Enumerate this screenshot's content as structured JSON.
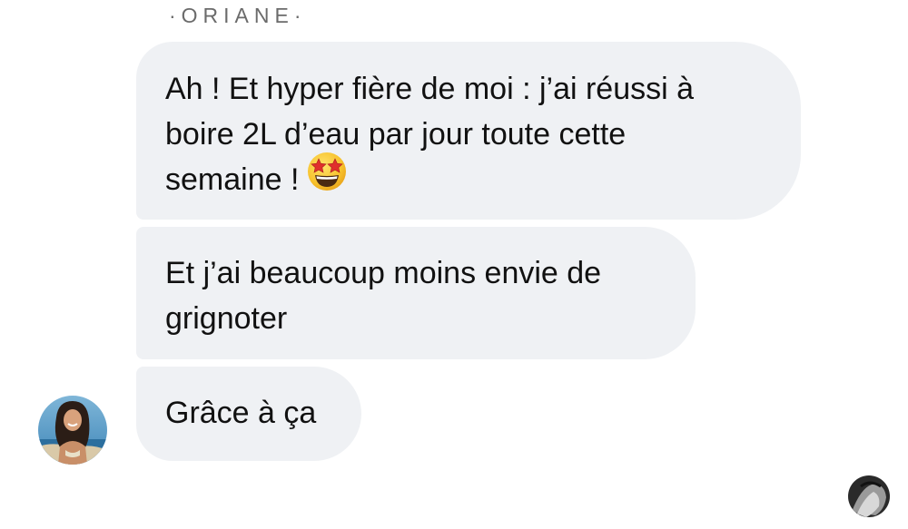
{
  "conversation": {
    "sender_name": "·ORIANE·",
    "messages": [
      {
        "lines": [
          "Ah ! Et hyper fière de moi : j’ai réussi à",
          "boire 2L d’eau par jour toute cette",
          "semaine !"
        ],
        "emoji": "star-struck-emoji"
      },
      {
        "lines": [
          "Et j’ai beaucoup moins envie de",
          "grignoter"
        ]
      },
      {
        "lines": [
          "Grâce à ça"
        ]
      }
    ]
  },
  "colors": {
    "bubble_background": "#eff1f4",
    "text": "#111111",
    "sender_name": "#6b6b6b"
  }
}
